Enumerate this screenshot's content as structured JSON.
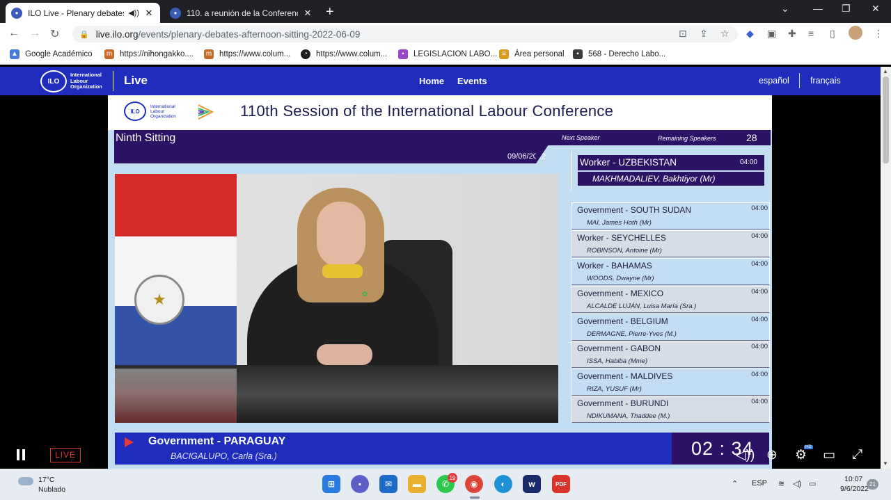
{
  "browser": {
    "tabs": [
      {
        "title": "ILO Live - Plenary debates -",
        "active": true
      },
      {
        "title": "110. a reunión de la Conferencia",
        "active": false
      }
    ],
    "url_host": "live.ilo.org",
    "url_path": "/events/plenary-debates-afternoon-sitting-2022-06-09",
    "bookmarks": [
      {
        "label": "Google Académico",
        "icon": "graduation-cap-icon"
      },
      {
        "label": "https://nihongakko....",
        "icon": "site-icon"
      },
      {
        "label": "https://www.colum...",
        "icon": "site-icon"
      },
      {
        "label": "https://www.colum...",
        "icon": "whatsapp-icon"
      },
      {
        "label": "LEGISLACION LABO...",
        "icon": "classroom-icon"
      },
      {
        "label": "Área personal",
        "icon": "moodle-icon"
      },
      {
        "label": "568 - Derecho Labo...",
        "icon": "classroom-icon"
      }
    ]
  },
  "site": {
    "org": "International Labour Organization",
    "logo_text": "ILO",
    "live": "Live",
    "nav": [
      "Home",
      "Events"
    ],
    "languages": [
      "español",
      "français"
    ],
    "colors": {
      "primary": "#1e2dbe",
      "dark_purple": "#2b1265",
      "panel": "#c3ddf2"
    }
  },
  "stream": {
    "conference_title": "110th Session of the International Labour Conference",
    "org_small": "International Labour Organization",
    "sitting": "Ninth Sitting",
    "date": "09/06/2022",
    "next_label": "Next Speaker",
    "remaining_label": "Remaining Speakers",
    "remaining_count": "28",
    "next_speaker": {
      "country": "Worker - UZBEKISTAN",
      "time": "04:00",
      "name": "MAKHMADALIEV, Bakhtiyor (Mr)"
    },
    "queue": [
      {
        "country": "Government - SOUTH SUDAN",
        "time": "04:00",
        "name": "MAI, James Hoth (Mr)"
      },
      {
        "country": "Worker - SEYCHELLES",
        "time": "04:00",
        "name": "ROBINSON, Antoine (Mr)"
      },
      {
        "country": "Worker - BAHAMAS",
        "time": "04:00",
        "name": "WOODS, Dwayne (Mr)"
      },
      {
        "country": "Government - MEXICO",
        "time": "04:00",
        "name": "ALCALDE LUJÁN, Luisa María (Sra.)"
      },
      {
        "country": "Government - BELGIUM",
        "time": "04:00",
        "name": "DERMAGNE, Pierre-Yves (M.)"
      },
      {
        "country": "Government - GABON",
        "time": "04:00",
        "name": "ISSA, Habiba (Mme)"
      },
      {
        "country": "Government - MALDIVES",
        "time": "04:00",
        "name": "RIZA, YUSUF (Mr)"
      },
      {
        "country": "Government - BURUNDI",
        "time": "04:00",
        "name": "NDIKUMANA, Thaddee (M.)"
      }
    ],
    "current_speaker": {
      "country": "Government - PARAGUAY",
      "name": "BACIGALUPO, Carla (Sra.)"
    },
    "timer": "02 : 34"
  },
  "player": {
    "live_label": "LIVE",
    "hd": "HD"
  },
  "taskbar": {
    "weather_temp": "17°C",
    "weather_desc": "Nublado",
    "whatsapp_badge": "19",
    "lang": "ESP",
    "time": "10:07",
    "date": "9/6/2022",
    "notifications": "21"
  }
}
